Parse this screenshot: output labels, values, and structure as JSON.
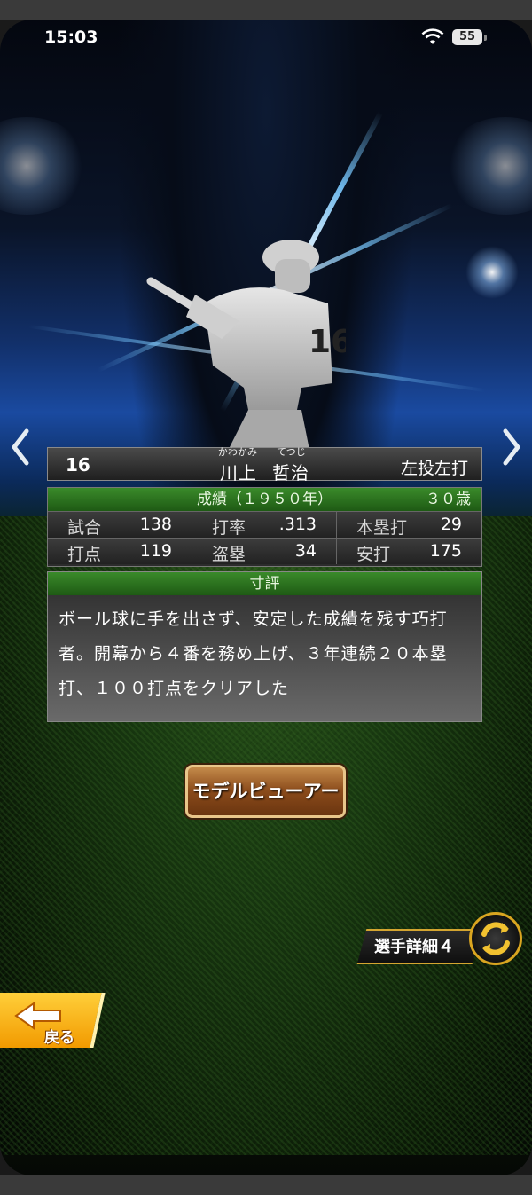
{
  "status_bar": {
    "time": "15:03",
    "battery": "55"
  },
  "player": {
    "number": "16",
    "name_ruby_family": "かわかみ",
    "name_ruby_given": "てつじ",
    "name_family": "川上",
    "name_given": "哲治",
    "throw_bat": "左投左打"
  },
  "stats": {
    "header": "成績（１９５０年）",
    "age": "３０歳",
    "cells": [
      {
        "label": "試合",
        "value": "138"
      },
      {
        "label": "打率",
        "value": ".313"
      },
      {
        "label": "本塁打",
        "value": "29"
      },
      {
        "label": "打点",
        "value": "119"
      },
      {
        "label": "盗塁",
        "value": "34"
      },
      {
        "label": "安打",
        "value": "175"
      }
    ]
  },
  "review": {
    "header": "寸評",
    "lines": [
      "ボール球に手を出さず、安定した成績を残す巧打",
      "者。開幕から４番を務め上げ、３年連続２０本塁",
      "打、１００打点をクリアした"
    ]
  },
  "buttons": {
    "model_viewer": "モデルビューアー",
    "player_detail": "選手詳細４",
    "back": "戻る"
  },
  "icons": {
    "prev": "chevron-left-icon",
    "next": "chevron-right-icon",
    "cycle": "cycle-icon",
    "wifi": "wifi-icon"
  }
}
